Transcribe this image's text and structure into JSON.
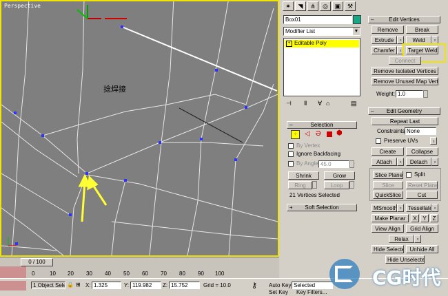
{
  "viewport": {
    "label": "Perspective",
    "overlay_text": "捻焊接",
    "frame_counter": "0 / 100"
  },
  "timeline": {
    "ticks": [
      "0",
      "10",
      "20",
      "30",
      "40",
      "50",
      "60",
      "70",
      "80",
      "90",
      "100"
    ]
  },
  "statusbar": {
    "selection": "1 Object Sele",
    "x_label": "X:",
    "x_value": "1.325",
    "y_label": "Y:",
    "y_value": "119.982",
    "z_label": "Z:",
    "z_value": "15.752",
    "grid": "Grid = 10.0",
    "auto_key": "Auto Key",
    "key_mode": "Selected",
    "set_key": "Set Key",
    "key_filters": "Key Filters..."
  },
  "command_panel": {
    "object_name": "Box01",
    "modifier_list": "Modifier List",
    "stack_item": "Editable Poly"
  },
  "selection_rollout": {
    "title": "Selection",
    "by_vertex": "By Vertex",
    "ignore_backfacing": "Ignore Backfacing",
    "by_angle": "By Angle:",
    "angle_value": "45.0",
    "shrink": "Shrink",
    "grow": "Grow",
    "ring": "Ring",
    "loop": "Loop",
    "status": "21 Vertices Selected",
    "soft_selection": "Soft Selection"
  },
  "edit_vertices": {
    "title": "Edit Vertices",
    "remove": "Remove",
    "break": "Break",
    "extrude": "Extrude",
    "weld": "Weld",
    "chamfer": "Chamfer",
    "target_weld": "Target Weld",
    "connect": "Connect",
    "remove_isolated": "Remove Isolated Vertices",
    "remove_unused": "Remove Unused Map Verts",
    "weight_label": "Weight:",
    "weight_value": "1.0"
  },
  "edit_geometry": {
    "title": "Edit Geometry",
    "repeat_last": "Repeat Last",
    "constraints_label": "Constraints:",
    "constraints_value": "None",
    "preserve_uvs": "Preserve UVs",
    "create": "Create",
    "collapse": "Collapse",
    "attach": "Attach",
    "detach": "Detach",
    "slice_plane": "Slice Plane",
    "split": "Split",
    "slice": "Slice",
    "reset_plane": "Reset Plane",
    "quickslice": "QuickSlice",
    "cut": "Cut",
    "msmooth": "MSmooth",
    "tessellate": "Tessellate",
    "make_planar": "Make Planar",
    "x": "X",
    "y": "Y",
    "z": "Z",
    "view_align": "View Align",
    "grid_align": "Grid Align",
    "relax": "Relax",
    "hide_selected": "Hide Selected",
    "unhide_all": "Unhide All",
    "hide_unselected": "Hide Unselected"
  },
  "watermark": {
    "text": "CG时代"
  },
  "colors": {
    "viewport_bg": "#7f7f7f",
    "viewport_border": "#f0e400",
    "highlight": "#ffff00",
    "arrow": "#ffff33",
    "object_color": "#14a887"
  }
}
